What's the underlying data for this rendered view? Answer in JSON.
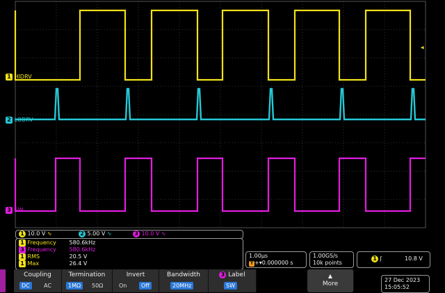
{
  "traces": [
    {
      "id": "1",
      "label": "HIDRV",
      "color": "#f2e21a",
      "high": 15,
      "low": 115,
      "edges": [
        22,
        115,
        180,
        218,
        284,
        320,
        386,
        424,
        488,
        526,
        590
      ]
    },
    {
      "id": "2",
      "label": "LODRV",
      "color": "#25c9d6",
      "base": 172,
      "peak": 128,
      "spikes": [
        82,
        184,
        286,
        390,
        492,
        594
      ]
    },
    {
      "id": "3",
      "label": "SW",
      "color": "#e21de0",
      "high": 228,
      "low": 304,
      "edges": [
        22,
        80,
        115,
        180,
        218,
        284,
        320,
        386,
        424,
        488,
        526,
        590
      ]
    }
  ],
  "channel_bar": [
    {
      "ch": "1",
      "value": "10.0 V",
      "color": "#f2e21a"
    },
    {
      "ch": "2",
      "value": "5.00 V",
      "color": "#25c9d6"
    },
    {
      "ch": "3",
      "value": "10.0 V",
      "color": "#e21de0"
    }
  ],
  "measurements": [
    {
      "ch": "1",
      "name": "Frequency",
      "value": "580.6kHz",
      "color": "#f2e21a"
    },
    {
      "ch": "3",
      "name": "Frequency",
      "value": "580.6kHz",
      "color": "#e21de0"
    },
    {
      "ch": "1",
      "name": "RMS",
      "value": "20.5 V",
      "color": "#f2e21a"
    },
    {
      "ch": "1",
      "name": "Max",
      "value": "26.4 V",
      "color": "#f2e21a"
    }
  ],
  "horizontal": {
    "scale": "1.00µs",
    "delay": "+▾0.000000 s",
    "rate": "1.00GS/s",
    "points": "10k points"
  },
  "trigger": {
    "ch": "1",
    "level": "10.8 V"
  },
  "menu": {
    "coupling": {
      "title": "Coupling",
      "options": [
        "DC",
        "AC"
      ],
      "selected": "DC"
    },
    "termination": {
      "title": "Termination",
      "options": [
        "1MΩ",
        "50Ω"
      ],
      "selected": "1MΩ"
    },
    "invert": {
      "title": "Invert",
      "options": [
        "On",
        "Off"
      ],
      "selected": "Off"
    },
    "bandwidth": {
      "title": "Bandwidth",
      "value": "20MHz"
    },
    "label": {
      "ch": "3",
      "title": "Label",
      "value": "SW"
    },
    "more": "More"
  },
  "datetime": {
    "date": "27 Dec 2023",
    "time": "15:05:52"
  }
}
